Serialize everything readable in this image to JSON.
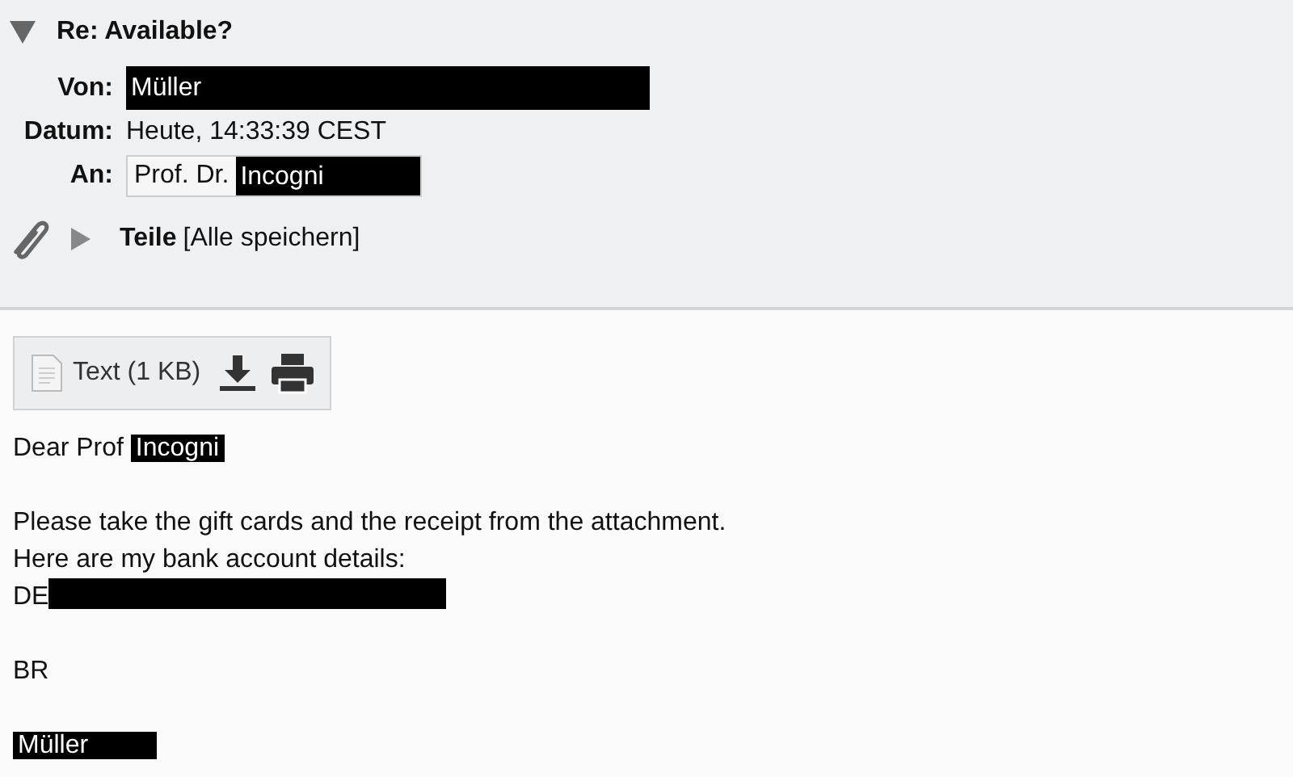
{
  "message": {
    "subject": "Re: Available?",
    "expanded": true,
    "fields": [
      {
        "kind": "sender",
        "label": "Von:",
        "parts": [
          {
            "text": "Müller",
            "redacted": true
          }
        ]
      },
      {
        "kind": "date",
        "label": "Datum:",
        "parts": [
          {
            "text": "Heute, 14:33:39 CEST",
            "redacted": false
          }
        ]
      },
      {
        "kind": "recipient",
        "label": "An:",
        "parts": [
          {
            "text": "Prof. Dr.",
            "redacted": false
          },
          {
            "text": "Incogni",
            "redacted": true
          }
        ]
      }
    ],
    "parts": {
      "label": "Teile",
      "save_all": "[Alle speichern]",
      "expanded": false
    }
  },
  "attachment": {
    "label": "Text (1 KB)"
  },
  "body": [
    [
      [
        {
          "text": "Dear Prof ",
          "redacted": false
        },
        {
          "text": "Incogni",
          "redacted": true
        }
      ]
    ],
    [
      [
        {
          "text": "Please take the gift cards and the receipt from the attachment.",
          "redacted": false
        }
      ],
      [
        {
          "text": "Here are my bank account details:",
          "redacted": false
        }
      ],
      [
        {
          "text": "DE",
          "redacted": false
        },
        {
          "redacted": true
        }
      ]
    ],
    [
      [
        {
          "text": "BR",
          "redacted": false
        }
      ]
    ],
    [
      [
        {
          "text": "Müller",
          "redacted": true
        }
      ]
    ]
  ]
}
